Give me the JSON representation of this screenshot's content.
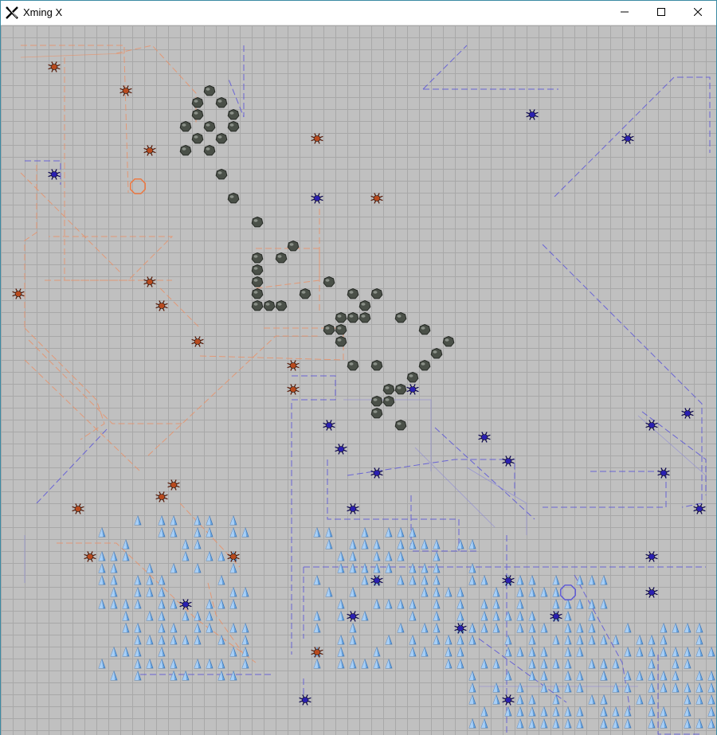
{
  "window": {
    "title": "Xming X"
  },
  "icons": {
    "app": "xming-x-icon",
    "minimize": "minimize-icon",
    "maximize": "maximize-icon",
    "close": "close-icon"
  },
  "colors": {
    "board_bg": "#c0c0c0",
    "grid": "#a8a8a8",
    "orange_team": "#d2691e",
    "blue_team": "#1a0f8c",
    "rock": "#4a5048",
    "crystal": "#6aa6e0"
  },
  "board": {
    "grid_cols": 60,
    "grid_rows": 59,
    "rocks": [
      [
        17,
        5
      ],
      [
        16,
        6
      ],
      [
        18,
        6
      ],
      [
        16,
        7
      ],
      [
        19,
        7
      ],
      [
        15,
        8
      ],
      [
        17,
        8
      ],
      [
        19,
        8
      ],
      [
        16,
        9
      ],
      [
        18,
        9
      ],
      [
        15,
        10
      ],
      [
        17,
        10
      ],
      [
        18,
        12
      ],
      [
        19,
        14
      ],
      [
        21,
        16
      ],
      [
        24,
        18
      ],
      [
        21,
        19
      ],
      [
        23,
        19
      ],
      [
        21,
        20
      ],
      [
        21,
        21
      ],
      [
        21,
        22
      ],
      [
        25,
        22
      ],
      [
        27,
        21
      ],
      [
        21,
        23
      ],
      [
        22,
        23
      ],
      [
        23,
        23
      ],
      [
        29,
        22
      ],
      [
        30,
        23
      ],
      [
        31,
        22
      ],
      [
        28,
        24
      ],
      [
        29,
        24
      ],
      [
        30,
        24
      ],
      [
        33,
        24
      ],
      [
        27,
        25
      ],
      [
        28,
        25
      ],
      [
        35,
        25
      ],
      [
        28,
        26
      ],
      [
        37,
        26
      ],
      [
        36,
        27
      ],
      [
        29,
        28
      ],
      [
        31,
        28
      ],
      [
        35,
        28
      ],
      [
        34,
        29
      ],
      [
        32,
        30
      ],
      [
        33,
        30
      ],
      [
        31,
        31
      ],
      [
        32,
        31
      ],
      [
        31,
        32
      ],
      [
        33,
        33
      ]
    ],
    "crystal_fields": [
      {
        "col_start": 8,
        "col_end": 20,
        "row_start": 41,
        "row_end": 54,
        "density": 0.55
      },
      {
        "col_start": 26,
        "col_end": 39,
        "row_start": 42,
        "row_end": 53,
        "density": 0.55
      },
      {
        "col_start": 39,
        "col_end": 50,
        "row_start": 46,
        "row_end": 58,
        "density": 0.6
      },
      {
        "col_start": 50,
        "col_end": 59,
        "row_start": 50,
        "row_end": 58,
        "density": 0.55
      }
    ],
    "orange_units": [
      [
        4,
        3
      ],
      [
        10,
        5
      ],
      [
        12,
        10
      ],
      [
        26,
        9
      ],
      [
        31,
        14
      ],
      [
        12,
        21
      ],
      [
        1,
        22
      ],
      [
        13,
        23
      ],
      [
        16,
        26
      ],
      [
        24,
        28
      ],
      [
        24,
        30
      ],
      [
        14,
        38
      ],
      [
        13,
        39
      ],
      [
        6,
        40
      ],
      [
        7,
        44
      ],
      [
        19,
        44
      ],
      [
        26,
        52
      ]
    ],
    "blue_units": [
      [
        4,
        12
      ],
      [
        26,
        14
      ],
      [
        44,
        7
      ],
      [
        52,
        9
      ],
      [
        34,
        30
      ],
      [
        27,
        33
      ],
      [
        28,
        35
      ],
      [
        31,
        37
      ],
      [
        40,
        34
      ],
      [
        42,
        36
      ],
      [
        29,
        40
      ],
      [
        57,
        32
      ],
      [
        54,
        33
      ],
      [
        55,
        37
      ],
      [
        58,
        40
      ],
      [
        31,
        46
      ],
      [
        15,
        48
      ],
      [
        29,
        49
      ],
      [
        38,
        50
      ],
      [
        42,
        46
      ],
      [
        46,
        49
      ],
      [
        54,
        44
      ],
      [
        54,
        47
      ],
      [
        25,
        56
      ],
      [
        42,
        56
      ]
    ],
    "orange_bases": [
      [
        11,
        13
      ]
    ],
    "blue_bases": [
      [
        47,
        47
      ]
    ]
  }
}
